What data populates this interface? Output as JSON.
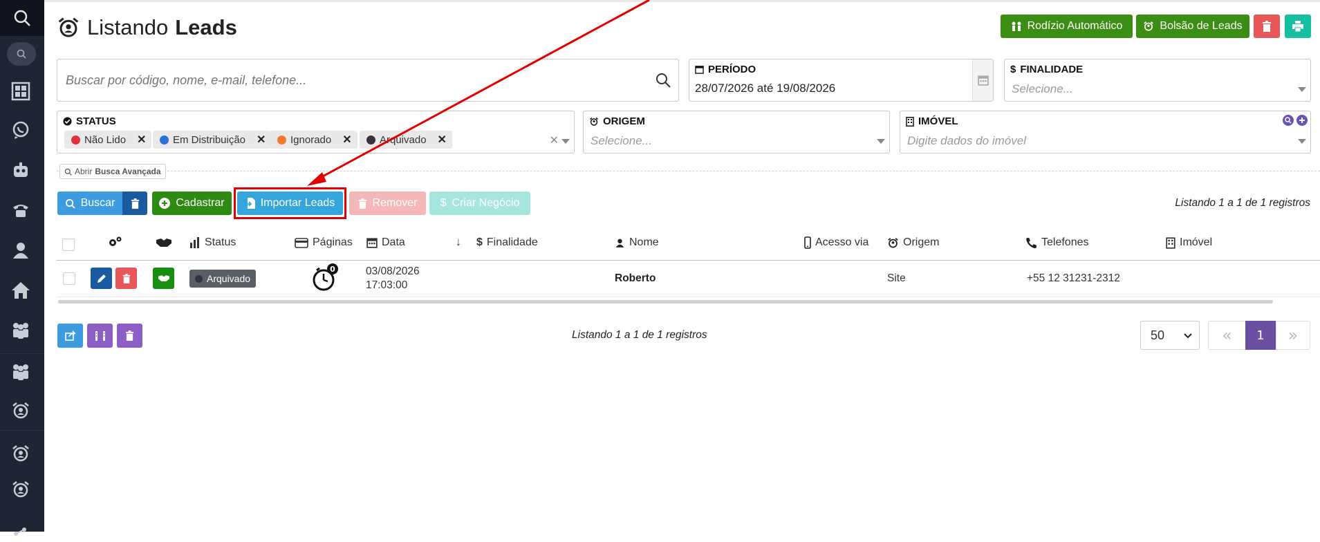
{
  "page": {
    "title_prefix": "Listando",
    "title_bold": "Leads"
  },
  "header_buttons": {
    "rodizio": "Rodízio Automático",
    "bolsao": "Bolsão de Leads"
  },
  "search": {
    "placeholder": "Buscar por código, nome, e-mail, telefone..."
  },
  "periodo": {
    "label": "PERÍODO",
    "value": "28/07/2026 até 19/08/2026"
  },
  "finalidade": {
    "label": "FINALIDADE",
    "placeholder": "Selecione..."
  },
  "status_filter": {
    "label": "STATUS",
    "chips": [
      {
        "label": "Não Lido",
        "color": "#e0303a"
      },
      {
        "label": "Em Distribuição",
        "color": "#2f6fd8"
      },
      {
        "label": "Ignorado",
        "color": "#f27a2a"
      },
      {
        "label": "Arquivado",
        "color": "#3a2f3f"
      }
    ]
  },
  "origem": {
    "label": "ORIGEM",
    "placeholder": "Selecione..."
  },
  "imovel": {
    "label": "IMÓVEL",
    "placeholder": "Digite dados do imóvel"
  },
  "advanced_search": {
    "prefix": "Abrir",
    "bold": "Busca Avançada"
  },
  "actions": {
    "buscar": "Buscar",
    "cadastrar": "Cadastrar",
    "importar": "Importar Leads",
    "remover": "Remover",
    "criar_negocio": "Criar Negócio"
  },
  "listing_info": "Listando 1 a 1 de 1 registros",
  "table": {
    "headers": {
      "status": "Status",
      "paginas": "Páginas",
      "data": "Data",
      "finalidade": "Finalidade",
      "nome": "Nome",
      "acesso": "Acesso via",
      "origem": "Origem",
      "telefones": "Telefones",
      "imovel": "Imóvel"
    },
    "rows": [
      {
        "status": "Arquivado",
        "paginas_count": "0",
        "date": "03/08/2026",
        "time": "17:03:00",
        "nome": "Roberto",
        "origem": "Site",
        "telefone": "+55 12 31231-2312"
      }
    ]
  },
  "footer": {
    "per_page": "50",
    "current_page": "1"
  },
  "colors": {
    "green": "#3b8e14",
    "red": "#e8585a",
    "teal": "#14bfa0",
    "blue": "#3d9cdf",
    "purple": "#8c5fc6",
    "pager_active": "#6a4fa0",
    "annotation": "#e00000"
  }
}
